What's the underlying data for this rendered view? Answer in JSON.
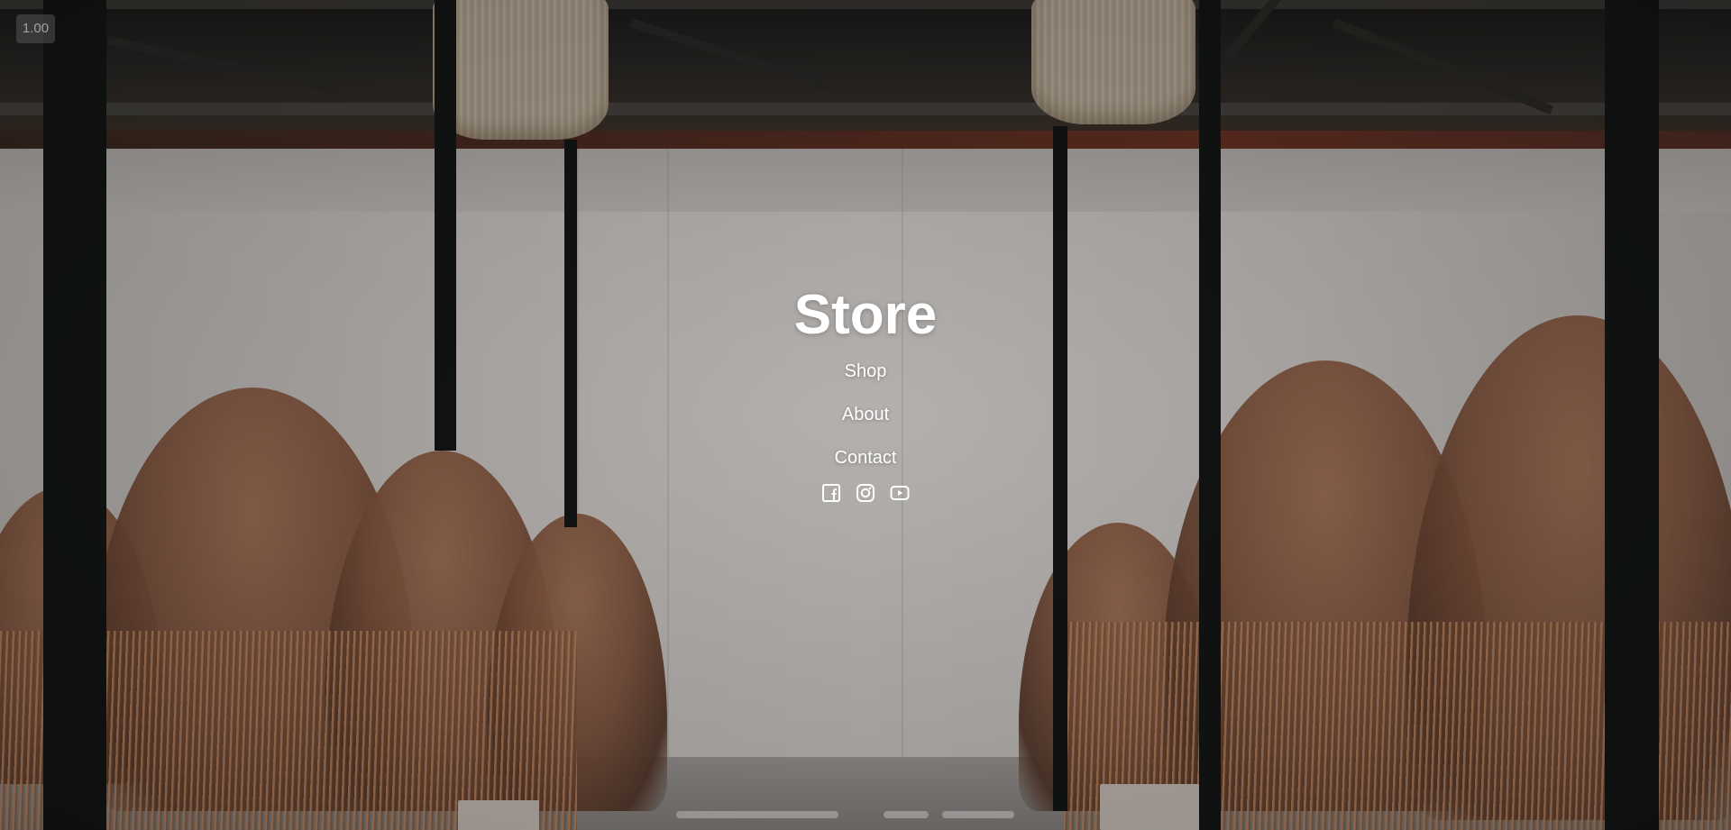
{
  "zoom_badge": "1.00",
  "brand": {
    "title": "Store"
  },
  "nav": {
    "items": [
      {
        "label": "Shop"
      },
      {
        "label": "About"
      },
      {
        "label": "Contact"
      }
    ]
  },
  "social": {
    "icons": [
      "facebook-icon",
      "instagram-icon",
      "youtube-icon"
    ]
  },
  "colors": {
    "text": "#ffffff",
    "background_wall": "#d4d0cd",
    "pampas_grass": "#a87558",
    "poles": "#141816"
  }
}
